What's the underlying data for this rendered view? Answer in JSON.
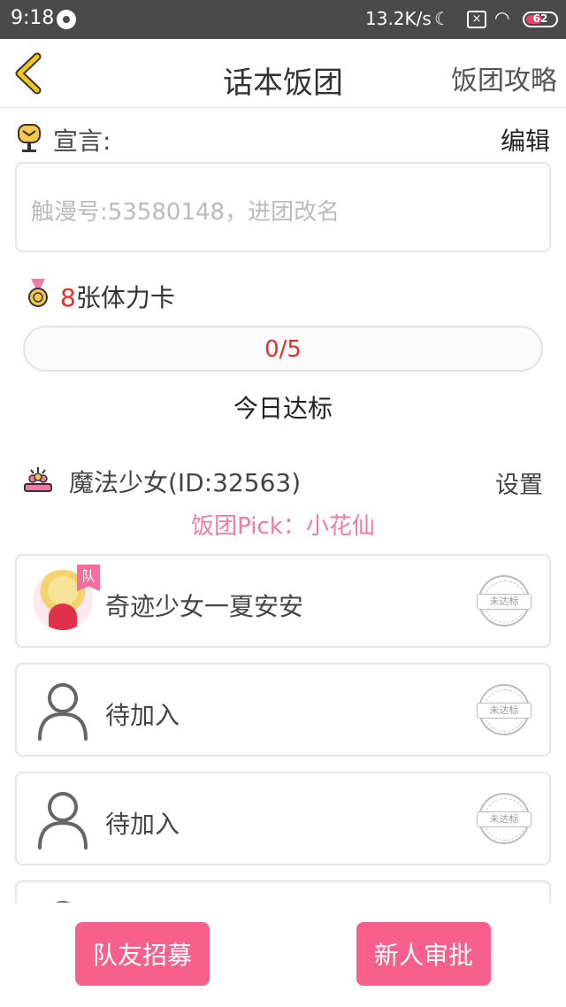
{
  "status_bar": {
    "time": "9:18",
    "network_speed": "13.2K/s",
    "battery_level": "62"
  },
  "nav": {
    "title": "话本饭团",
    "guide_label": "饭团攻略"
  },
  "slogan": {
    "label": "宣言:",
    "edit_label": "编辑",
    "text": "触漫号:53580148，进团改名"
  },
  "stamina_card": {
    "count": "8",
    "label": "张体力卡"
  },
  "progress": {
    "text": "0/5",
    "value": 0,
    "max": 5,
    "today_label": "今日达标"
  },
  "team": {
    "name": "魔法少女(ID:32563)",
    "settings_label": "设置",
    "pick": "饭团Pick：小花仙"
  },
  "members": [
    {
      "name": "奇迹少女一夏安安",
      "badge": "队",
      "status": "未达标"
    },
    {
      "name": "待加入",
      "status": "未达标"
    },
    {
      "name": "待加入",
      "status": "未达标"
    }
  ],
  "bottom": {
    "recruit_label": "队友招募",
    "approve_label": "新人审批"
  },
  "colors": {
    "accent_pink": "#f7608d",
    "pick_pink": "#f07aa5",
    "number_red": "#e0302e",
    "back_arrow": "#f5c518"
  }
}
